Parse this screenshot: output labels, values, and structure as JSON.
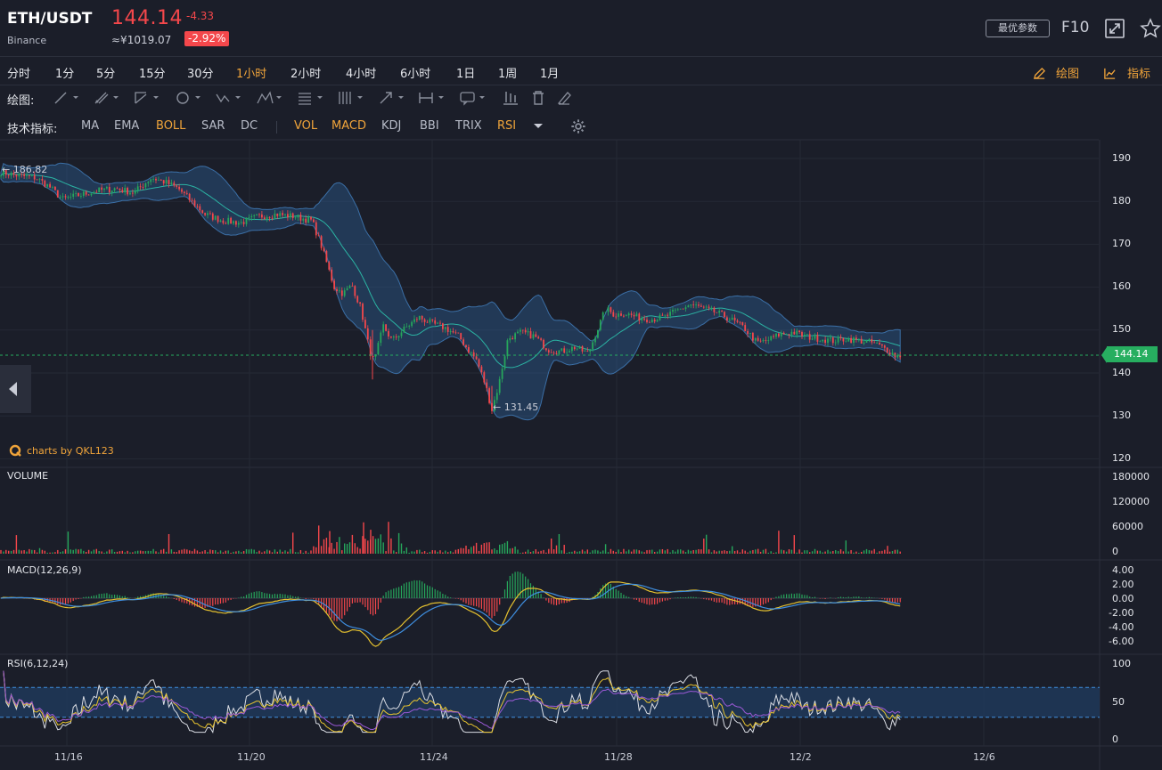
{
  "header": {
    "symbol": "ETH/USDT",
    "exchange": "Binance",
    "price": "144.14",
    "change": "-4.33",
    "cny_price": "≈¥1019.07",
    "change_pct": "-2.92%",
    "best_params_label": "最优参数",
    "f10_label": "F10"
  },
  "timeframes": [
    {
      "label": "分时"
    },
    {
      "label": "1分"
    },
    {
      "label": "5分"
    },
    {
      "label": "15分"
    },
    {
      "label": "30分"
    },
    {
      "label": "1小时"
    },
    {
      "label": "2小时"
    },
    {
      "label": "4小时"
    },
    {
      "label": "6小时"
    },
    {
      "label": "1日"
    },
    {
      "label": "1周"
    },
    {
      "label": "1月"
    }
  ],
  "active_timeframe": "1小时",
  "toolbar_right": {
    "draw_label": "绘图",
    "indicator_label": "指标"
  },
  "drawing": {
    "label": "绘图:"
  },
  "indicators": {
    "label": "技术指标:",
    "items": [
      {
        "label": "MA",
        "active": false
      },
      {
        "label": "EMA",
        "active": false
      },
      {
        "label": "BOLL",
        "active": true
      },
      {
        "label": "SAR",
        "active": false
      },
      {
        "label": "DC",
        "active": false
      },
      {
        "label": "VOL",
        "active": true
      },
      {
        "label": "MACD",
        "active": true
      },
      {
        "label": "KDJ",
        "active": false
      },
      {
        "label": "BBI",
        "active": false
      },
      {
        "label": "TRIX",
        "active": false
      },
      {
        "label": "RSI",
        "active": true
      }
    ]
  },
  "chart": {
    "brand": "charts by QKL123",
    "high_marker": "186.82",
    "low_marker": "131.45",
    "current_price_tag": "144.14",
    "volume_label": "VOLUME",
    "macd_label": "MACD(12,26,9)",
    "rsi_label": "RSI(6,12,24)"
  },
  "colors": {
    "up": "#26a65b",
    "down": "#f4474b",
    "accent": "#f0a43a",
    "boll_band": "#2c5c8f",
    "current_price": "#27ae60"
  },
  "chart_data": {
    "type": "candlestick",
    "price_axis": {
      "ticks": [
        190,
        180,
        170,
        160,
        150,
        140,
        130,
        120
      ],
      "ylim": [
        120,
        190
      ]
    },
    "volume_axis": {
      "ticks": [
        "180000",
        "120000",
        "60000",
        "0"
      ],
      "ylim": [
        0,
        180000
      ]
    },
    "macd_axis": {
      "ticks": [
        "4.00",
        "2.00",
        "0.00",
        "-2.00",
        "-4.00",
        "-6.00"
      ],
      "ylim": [
        -6,
        4
      ]
    },
    "rsi_axis": {
      "ticks": [
        "100",
        "50",
        "0"
      ],
      "ylim": [
        0,
        100
      ],
      "bands": [
        30,
        70
      ]
    },
    "x_ticks": [
      "11/16",
      "11/20",
      "11/24",
      "11/28",
      "12/2",
      "12/6"
    ],
    "price_path": [
      [
        0,
        186.82
      ],
      [
        20,
        186.0
      ],
      [
        40,
        185.5
      ],
      [
        55,
        183.5
      ],
      [
        70,
        180.5
      ],
      [
        90,
        181.5
      ],
      [
        110,
        182.5
      ],
      [
        130,
        183.0
      ],
      [
        150,
        182.0
      ],
      [
        170,
        185.5
      ],
      [
        185,
        184.5
      ],
      [
        200,
        183.0
      ],
      [
        215,
        180.0
      ],
      [
        230,
        177.0
      ],
      [
        250,
        175.5
      ],
      [
        270,
        175.0
      ],
      [
        290,
        176.5
      ],
      [
        310,
        177.0
      ],
      [
        330,
        176.5
      ],
      [
        350,
        175.5
      ],
      [
        360,
        170.0
      ],
      [
        375,
        160.0
      ],
      [
        385,
        158.5
      ],
      [
        395,
        160.5
      ],
      [
        405,
        155.0
      ],
      [
        415,
        145.0
      ],
      [
        420,
        142.5
      ],
      [
        430,
        151.0
      ],
      [
        440,
        147.5
      ],
      [
        455,
        150.5
      ],
      [
        470,
        153.0
      ],
      [
        485,
        151.5
      ],
      [
        500,
        150.5
      ],
      [
        515,
        148.5
      ],
      [
        525,
        145.5
      ],
      [
        535,
        143.0
      ],
      [
        545,
        137.0
      ],
      [
        552,
        131.45
      ],
      [
        560,
        137.5
      ],
      [
        570,
        148.0
      ],
      [
        585,
        149.5
      ],
      [
        600,
        148.5
      ],
      [
        615,
        145.5
      ],
      [
        630,
        145.0
      ],
      [
        645,
        146.0
      ],
      [
        660,
        144.5
      ],
      [
        670,
        150.0
      ],
      [
        680,
        155.0
      ],
      [
        690,
        153.5
      ],
      [
        700,
        154.0
      ],
      [
        715,
        153.0
      ],
      [
        730,
        152.5
      ],
      [
        745,
        153.0
      ],
      [
        760,
        154.5
      ],
      [
        775,
        156.0
      ],
      [
        790,
        155.0
      ],
      [
        805,
        154.0
      ],
      [
        820,
        152.5
      ],
      [
        835,
        150.5
      ],
      [
        850,
        147.0
      ],
      [
        860,
        147.5
      ],
      [
        875,
        149.0
      ],
      [
        890,
        149.5
      ],
      [
        905,
        148.5
      ],
      [
        920,
        148.0
      ],
      [
        935,
        147.5
      ],
      [
        950,
        148.0
      ],
      [
        965,
        147.5
      ],
      [
        980,
        147.0
      ],
      [
        995,
        145.5
      ],
      [
        1005,
        144.0
      ],
      [
        1013,
        144.14
      ]
    ],
    "current_price": 144.14,
    "high": 186.82,
    "low": 131.45
  }
}
